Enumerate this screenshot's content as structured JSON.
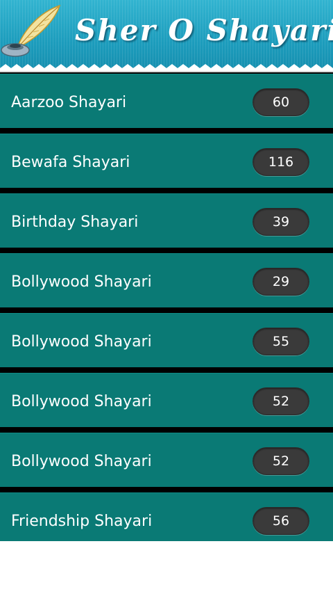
{
  "header": {
    "title": "Sher O Shayari",
    "logo_icon": "quill-and-inkpot-icon",
    "colors": {
      "header_blue": "#1c9cbc",
      "row_teal": "#0a7a75",
      "badge": "#3a3a3a"
    }
  },
  "categories": [
    {
      "label": "Aarzoo Shayari",
      "count": "60"
    },
    {
      "label": "Bewafa Shayari",
      "count": "116"
    },
    {
      "label": "Birthday Shayari",
      "count": "39"
    },
    {
      "label": "Bollywood Shayari",
      "count": "29"
    },
    {
      "label": "Bollywood Shayari",
      "count": "55"
    },
    {
      "label": "Bollywood Shayari",
      "count": "52"
    },
    {
      "label": "Bollywood Shayari",
      "count": "52"
    },
    {
      "label": "Friendship Shayari",
      "count": "56"
    }
  ]
}
